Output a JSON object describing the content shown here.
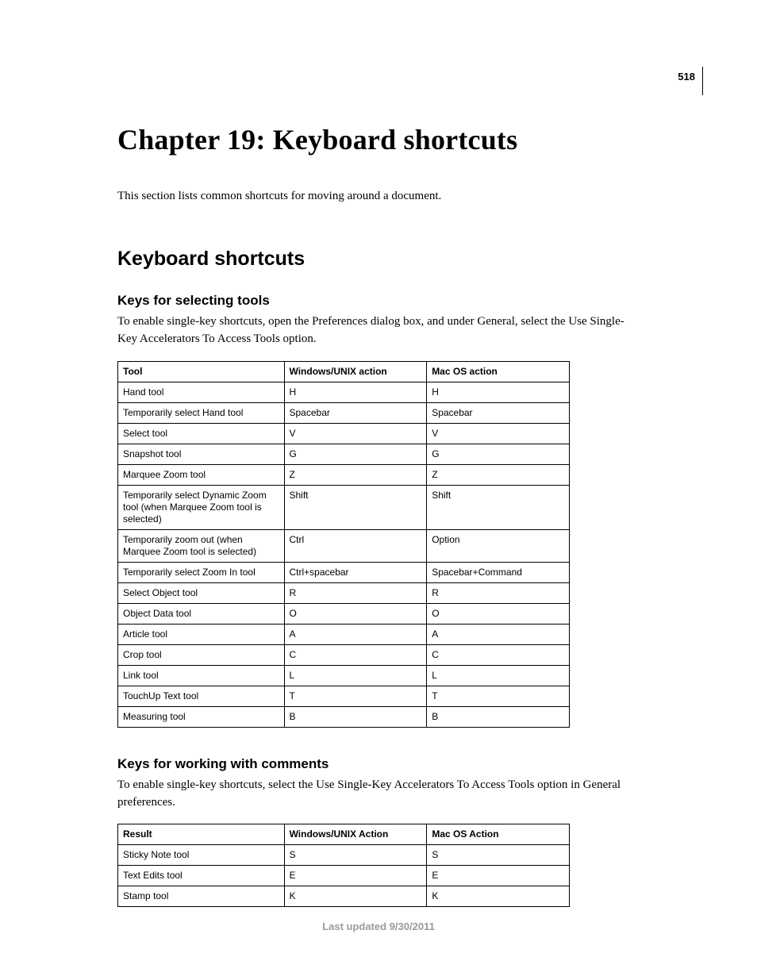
{
  "page_number": "518",
  "chapter_title": "Chapter 19: Keyboard shortcuts",
  "intro": "This section lists common shortcuts for moving around a document.",
  "section_title": "Keyboard shortcuts",
  "tools_section": {
    "heading": "Keys for selecting tools",
    "intro": "To enable single-key shortcuts, open the Preferences dialog box, and under General, select the Use Single-Key Accelerators To Access Tools option.",
    "headers": [
      "Tool",
      "Windows/UNIX action",
      "Mac OS action"
    ],
    "rows": [
      {
        "c0": "Hand tool",
        "c1": "H",
        "c2": "H"
      },
      {
        "c0": "Temporarily select Hand tool",
        "c1": "Spacebar",
        "c2": "Spacebar"
      },
      {
        "c0": "Select tool",
        "c1": "V",
        "c2": "V"
      },
      {
        "c0": "Snapshot tool",
        "c1": "G",
        "c2": "G"
      },
      {
        "c0": "Marquee Zoom tool",
        "c1": "Z",
        "c2": "Z"
      },
      {
        "c0": "Temporarily select Dynamic Zoom tool (when Marquee Zoom tool is selected)",
        "c1": "Shift",
        "c2": "Shift"
      },
      {
        "c0": "Temporarily zoom out (when Marquee Zoom tool is selected)",
        "c1": "Ctrl",
        "c2": "Option"
      },
      {
        "c0": "Temporarily select Zoom In tool",
        "c1": "Ctrl+spacebar",
        "c2": "Spacebar+Command"
      },
      {
        "c0": "Select Object tool",
        "c1": "R",
        "c2": "R"
      },
      {
        "c0": "Object Data tool",
        "c1": "O",
        "c2": "O"
      },
      {
        "c0": "Article tool",
        "c1": "A",
        "c2": "A"
      },
      {
        "c0": "Crop tool",
        "c1": "C",
        "c2": "C"
      },
      {
        "c0": "Link tool",
        "c1": "L",
        "c2": "L"
      },
      {
        "c0": "TouchUp Text tool",
        "c1": "T",
        "c2": "T"
      },
      {
        "c0": "Measuring tool",
        "c1": "B",
        "c2": "B"
      }
    ]
  },
  "comments_section": {
    "heading": "Keys for working with comments",
    "intro": "To enable single-key shortcuts, select the Use Single-Key Accelerators To Access Tools option in General preferences.",
    "headers": [
      "Result",
      "Windows/UNIX Action",
      "Mac OS Action"
    ],
    "rows": [
      {
        "c0": "Sticky Note tool",
        "c1": "S",
        "c2": "S"
      },
      {
        "c0": "Text Edits tool",
        "c1": "E",
        "c2": "E"
      },
      {
        "c0": "Stamp tool",
        "c1": "K",
        "c2": "K"
      }
    ]
  },
  "footer": "Last updated 9/30/2011"
}
